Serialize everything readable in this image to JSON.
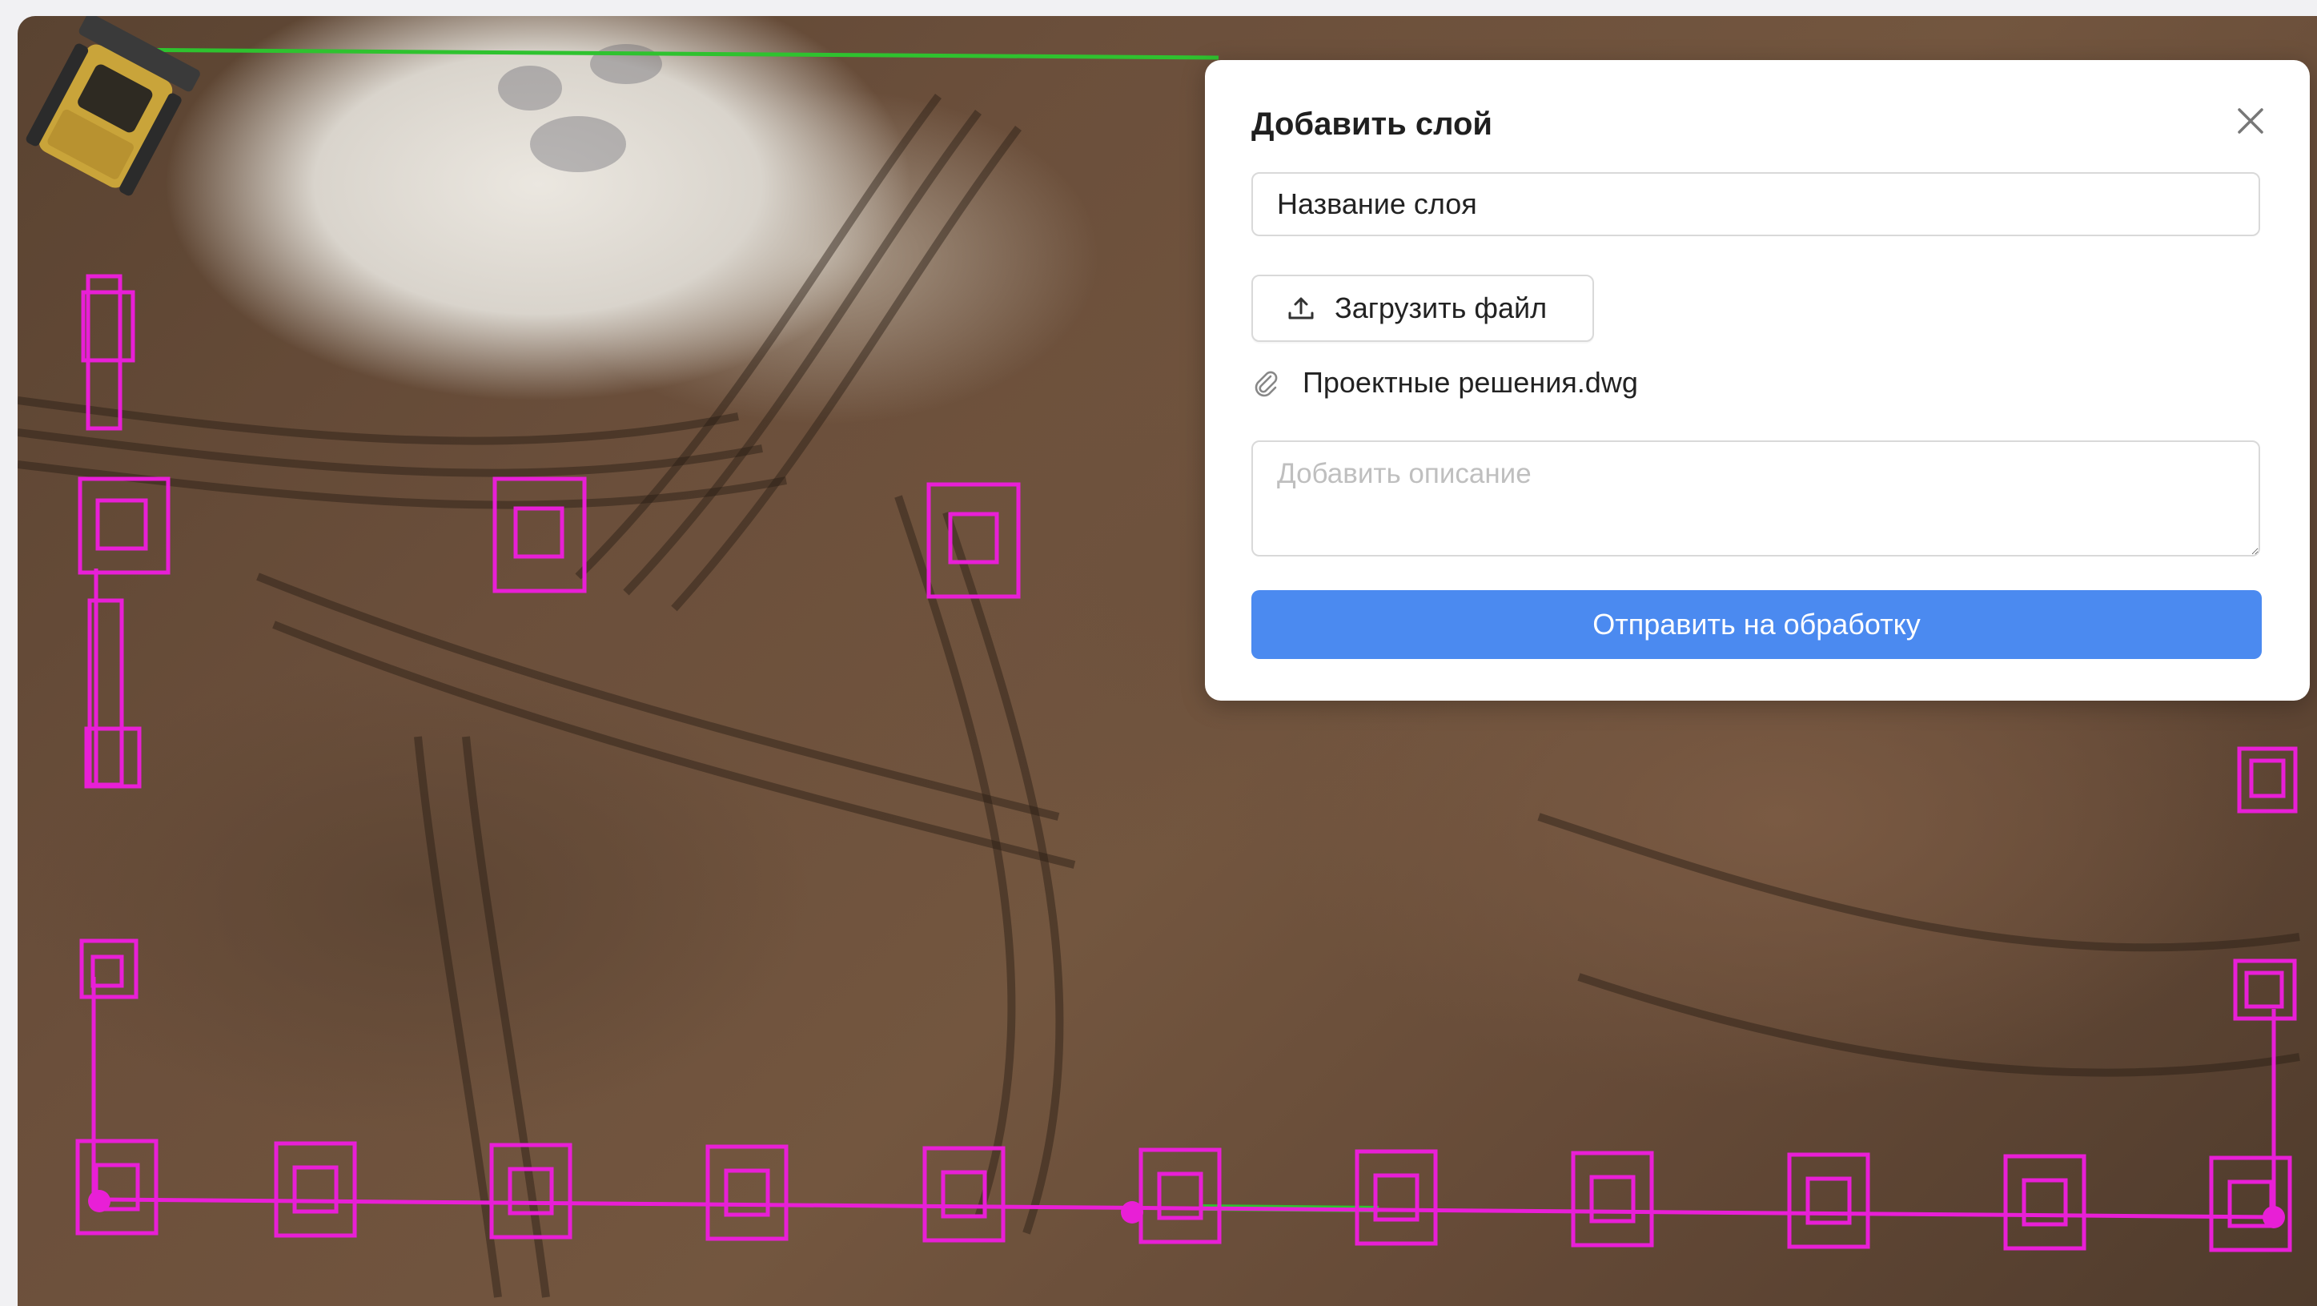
{
  "dialog": {
    "title": "Добавить слой",
    "layer_name_value": "Название слоя",
    "upload_button_label": "Загрузить файл",
    "attached_file_name": "Проектные решения.dwg",
    "description_placeholder": "Добавить описание",
    "submit_button_label": "Отправить на обработку"
  },
  "icons": {
    "close": "close-icon",
    "upload": "upload-icon",
    "attachment": "paperclip-icon"
  },
  "colors": {
    "overlay_magenta": "#e81fd6",
    "overlay_green": "#2fc22f",
    "primary_button": "#4b8af0"
  }
}
